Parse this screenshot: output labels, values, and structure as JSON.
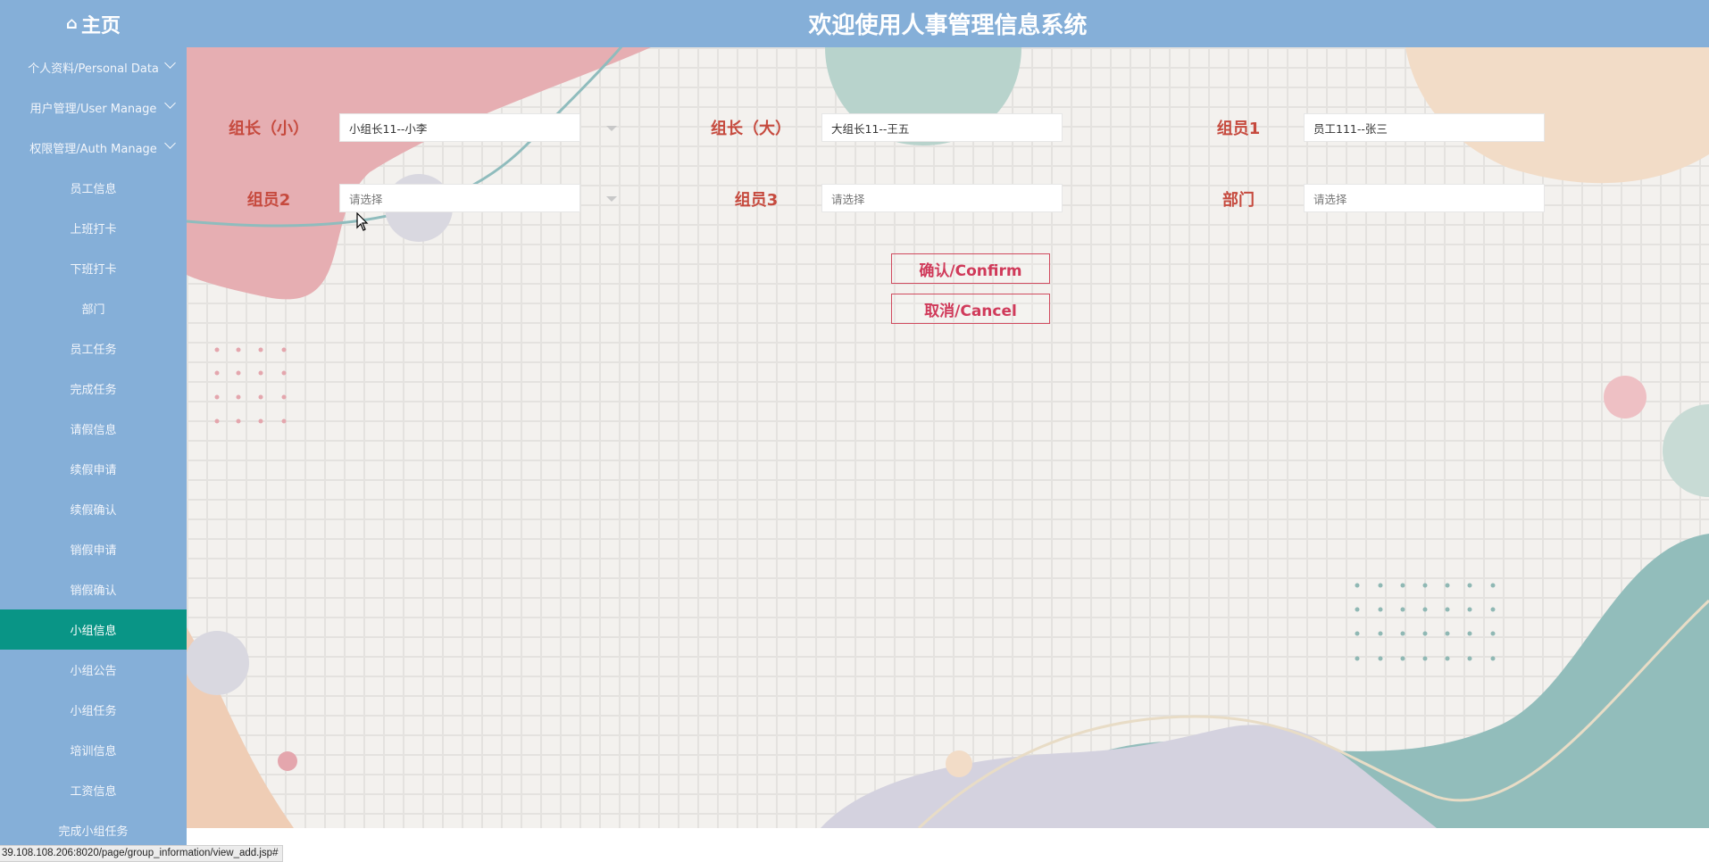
{
  "header": {
    "home_label": "主页",
    "home_icon": "home-icon",
    "title": "欢迎使用人事管理信息系统"
  },
  "sidebar": {
    "items": [
      {
        "label": "个人资料/Personal Data",
        "expandable": true
      },
      {
        "label": "用户管理/User Manage",
        "expandable": true
      },
      {
        "label": "权限管理/Auth Manage",
        "expandable": true
      },
      {
        "label": "员工信息"
      },
      {
        "label": "上班打卡"
      },
      {
        "label": "下班打卡"
      },
      {
        "label": "部门"
      },
      {
        "label": "员工任务"
      },
      {
        "label": "完成任务"
      },
      {
        "label": "请假信息"
      },
      {
        "label": "续假申请"
      },
      {
        "label": "续假确认"
      },
      {
        "label": "销假申请"
      },
      {
        "label": "销假确认"
      },
      {
        "label": "小组信息",
        "active": true
      },
      {
        "label": "小组公告"
      },
      {
        "label": "小组任务"
      },
      {
        "label": "培训信息"
      },
      {
        "label": "工资信息"
      },
      {
        "label": "完成小组任务"
      }
    ]
  },
  "form": {
    "leader_small": {
      "label": "组长（小）",
      "value": "小组长11--小李"
    },
    "leader_big": {
      "label": "组长（大）",
      "value": "大组长11--王五"
    },
    "member1": {
      "label": "组员1",
      "value": "员工111--张三"
    },
    "member2": {
      "label": "组员2",
      "placeholder": "请选择"
    },
    "member3": {
      "label": "组员3",
      "placeholder": "请选择"
    },
    "department": {
      "label": "部门",
      "placeholder": "请选择"
    }
  },
  "buttons": {
    "confirm": "确认/Confirm",
    "cancel": "取消/Cancel"
  },
  "status_bar": {
    "url": "39.108.108.206:8020/page/group_information/view_add.jsp#"
  },
  "colors": {
    "sidebar_bg": "#85afd8",
    "active_item": "#099586",
    "label_red": "#c64a3e",
    "button_red": "#d03a5a"
  }
}
